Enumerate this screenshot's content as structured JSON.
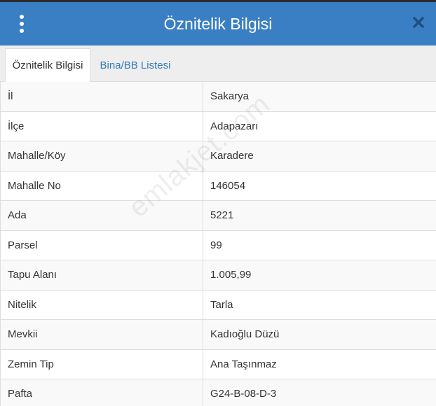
{
  "header": {
    "title": "Öznitelik Bilgisi",
    "menu_icon": "vertical-dots-icon",
    "close_icon": "close-icon",
    "background_color": "#3a7fc3"
  },
  "tabs": [
    {
      "label": "Öznitelik Bilgisi",
      "active": true
    },
    {
      "label": "Bina/BB Listesi",
      "active": false
    }
  ],
  "attributes": [
    {
      "label": "İl",
      "value": "Sakarya"
    },
    {
      "label": "İlçe",
      "value": "Adapazarı"
    },
    {
      "label": "Mahalle/Köy",
      "value": "Karadere"
    },
    {
      "label": "Mahalle No",
      "value": "146054"
    },
    {
      "label": "Ada",
      "value": "5221"
    },
    {
      "label": "Parsel",
      "value": "99"
    },
    {
      "label": "Tapu Alanı",
      "value": "1.005,99"
    },
    {
      "label": "Nitelik",
      "value": "Tarla"
    },
    {
      "label": "Mevkii",
      "value": "Kadıoğlu Düzü"
    },
    {
      "label": "Zemin Tip",
      "value": "Ana Taşınmaz"
    },
    {
      "label": "Pafta",
      "value": "G24-B-08-D-3"
    }
  ],
  "watermark": "emlakjet.com"
}
